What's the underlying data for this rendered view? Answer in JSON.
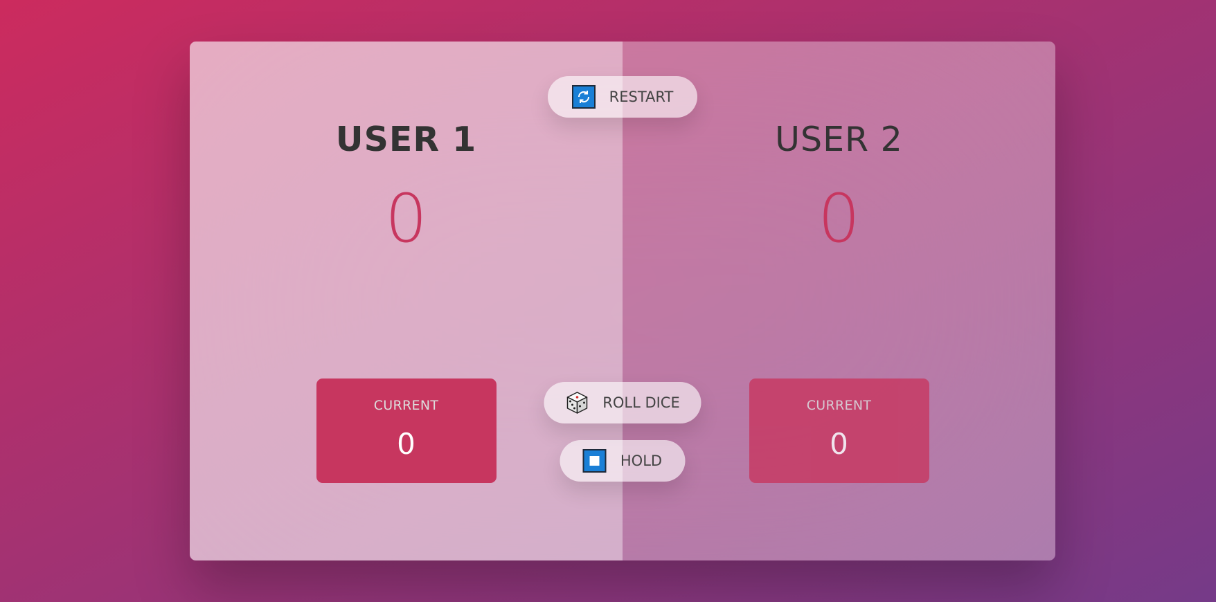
{
  "players": [
    {
      "name": "USER 1",
      "score": "0",
      "current_label": "CURRENT",
      "current": "0"
    },
    {
      "name": "USER 2",
      "score": "0",
      "current_label": "CURRENT",
      "current": "0"
    }
  ],
  "buttons": {
    "restart": "RESTART",
    "roll": "ROLL DICE",
    "hold": "HOLD"
  },
  "icons": {
    "restart": "refresh-icon",
    "roll": "dice-icon",
    "hold": "stop-icon"
  },
  "colors": {
    "accent": "#c7365f",
    "icon_blue": "#1a7fd6"
  }
}
